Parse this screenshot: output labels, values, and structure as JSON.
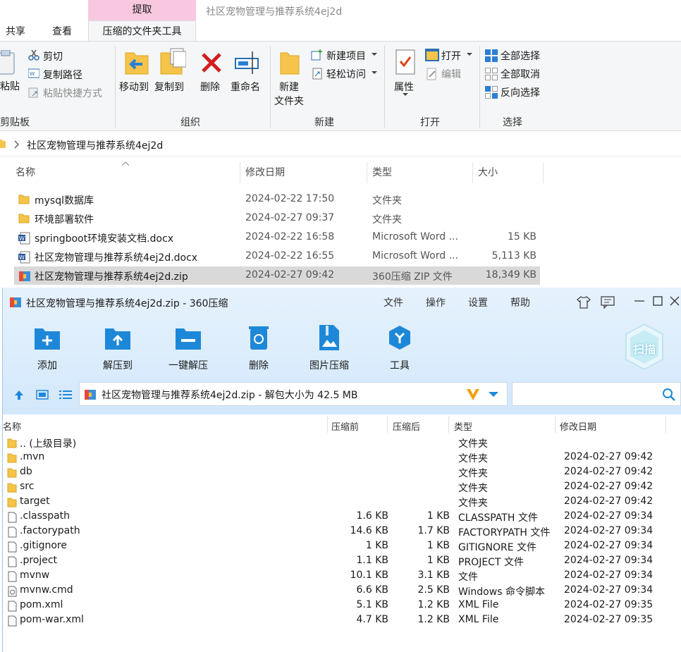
{
  "explorer": {
    "context_tab_header": "提取",
    "window_title": "社区宠物管理与推荐系统4ej2d",
    "tabs": [
      "共享",
      "查看"
    ],
    "active_tab": "压缩的文件夹工具",
    "clipboard": {
      "paste": "粘贴",
      "cut": "剪切",
      "copy_path": "复制路径",
      "paste_shortcut": "粘贴快捷方式",
      "group": "剪贴板"
    },
    "organize": {
      "move_to": "移动到",
      "copy_to": "复制到",
      "delete": "删除",
      "rename": "重命名",
      "group": "组织"
    },
    "new": {
      "new_folder_line1": "新建",
      "new_folder_line2": "文件夹",
      "new_item": "新建项目",
      "easy_access": "轻松访问",
      "group": "新建"
    },
    "open": {
      "properties": "属性",
      "open": "打开",
      "edit": "编辑",
      "group": "打开"
    },
    "select": {
      "select_all": "全部选择",
      "select_none": "全部取消",
      "invert": "反向选择",
      "group": "选择"
    },
    "breadcrumb": "社区宠物管理与推荐系统4ej2d",
    "columns": {
      "name": "名称",
      "modified": "修改日期",
      "type": "类型",
      "size": "大小"
    },
    "files": [
      {
        "name": "mysql数据库",
        "modified": "2024-02-22 17:50",
        "type": "文件夹",
        "size": "",
        "icon": "folder-icon"
      },
      {
        "name": "环境部署软件",
        "modified": "2024-02-27 09:37",
        "type": "文件夹",
        "size": "",
        "icon": "folder-icon"
      },
      {
        "name": "springboot环境安装文档.docx",
        "modified": "2024-02-22 16:58",
        "type": "Microsoft Word ...",
        "size": "15 KB",
        "icon": "word-doc-icon"
      },
      {
        "name": "社区宠物管理与推荐系统4ej2d.docx",
        "modified": "2024-02-22 16:55",
        "type": "Microsoft Word ...",
        "size": "5,113 KB",
        "icon": "word-doc-icon"
      },
      {
        "name": "社区宠物管理与推荐系统4ej2d.zip",
        "modified": "2024-02-27 09:42",
        "type": "360压缩 ZIP 文件",
        "size": "18,349 KB",
        "icon": "zip-archive-icon",
        "selected": true
      }
    ]
  },
  "zip": {
    "title": "社区宠物管理与推荐系统4ej2d.zip - 360压缩",
    "menu": [
      "文件",
      "操作",
      "设置",
      "帮助"
    ],
    "tools": [
      "添加",
      "解压到",
      "一键解压",
      "删除",
      "图片压缩",
      "工具"
    ],
    "scan_badge": "扫描",
    "path": "社区宠物管理与推荐系统4ej2d.zip - 解包大小为 42.5 MB",
    "columns": {
      "name": "名称",
      "before": "压缩前",
      "after": "压缩后",
      "type": "类型",
      "modified": "修改日期"
    },
    "rows": [
      {
        "name": ".. (上级目录)",
        "before": "",
        "after": "",
        "type": "文件夹",
        "modified": "",
        "icon": "folder-icon"
      },
      {
        "name": ".mvn",
        "before": "",
        "after": "",
        "type": "文件夹",
        "modified": "2024-02-27 09:42",
        "icon": "folder-icon"
      },
      {
        "name": "db",
        "before": "",
        "after": "",
        "type": "文件夹",
        "modified": "2024-02-27 09:42",
        "icon": "folder-icon"
      },
      {
        "name": "src",
        "before": "",
        "after": "",
        "type": "文件夹",
        "modified": "2024-02-27 09:42",
        "icon": "folder-icon"
      },
      {
        "name": "target",
        "before": "",
        "after": "",
        "type": "文件夹",
        "modified": "2024-02-27 09:42",
        "icon": "folder-icon"
      },
      {
        "name": ".classpath",
        "before": "1.6 KB",
        "after": "1 KB",
        "type": "CLASSPATH 文件",
        "modified": "2024-02-27 09:34",
        "icon": "file-icon"
      },
      {
        "name": ".factorypath",
        "before": "14.6 KB",
        "after": "1.7 KB",
        "type": "FACTORYPATH 文件",
        "modified": "2024-02-27 09:34",
        "icon": "file-icon"
      },
      {
        "name": ".gitignore",
        "before": "1 KB",
        "after": "1 KB",
        "type": "GITIGNORE 文件",
        "modified": "2024-02-27 09:34",
        "icon": "file-icon"
      },
      {
        "name": ".project",
        "before": "1.1 KB",
        "after": "1 KB",
        "type": "PROJECT 文件",
        "modified": "2024-02-27 09:34",
        "icon": "file-icon"
      },
      {
        "name": "mvnw",
        "before": "10.1 KB",
        "after": "3.1 KB",
        "type": "文件",
        "modified": "2024-02-27 09:34",
        "icon": "file-icon"
      },
      {
        "name": "mvnw.cmd",
        "before": "6.6 KB",
        "after": "2.5 KB",
        "type": "Windows 命令脚本",
        "modified": "2024-02-27 09:34",
        "icon": "cmd-script-icon"
      },
      {
        "name": "pom.xml",
        "before": "5.1 KB",
        "after": "1.2 KB",
        "type": "XML File",
        "modified": "2024-02-27 09:35",
        "icon": "file-icon"
      },
      {
        "name": "pom-war.xml",
        "before": "4.7 KB",
        "after": "1.2 KB",
        "type": "XML File",
        "modified": "2024-02-27 09:35",
        "icon": "file-icon"
      }
    ]
  },
  "colors": {
    "ribbon_context": "#f8c8e0",
    "zip_header": "#d3e8fb",
    "accent_blue": "#1e88d8",
    "selection": "#d9d9d9"
  }
}
